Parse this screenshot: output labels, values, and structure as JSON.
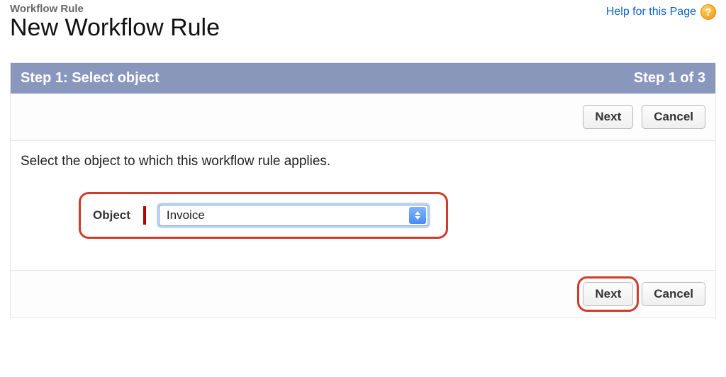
{
  "header": {
    "breadcrumb": "Workflow Rule",
    "title": "New Workflow Rule",
    "help_text": "Help for this Page",
    "help_icon_glyph": "?"
  },
  "wizard": {
    "step_title": "Step 1: Select object",
    "step_progress": "Step 1 of 3",
    "instruction": "Select the object to which this workflow rule applies.",
    "object_label": "Object",
    "object_value": "Invoice"
  },
  "buttons": {
    "next": "Next",
    "cancel": "Cancel"
  }
}
